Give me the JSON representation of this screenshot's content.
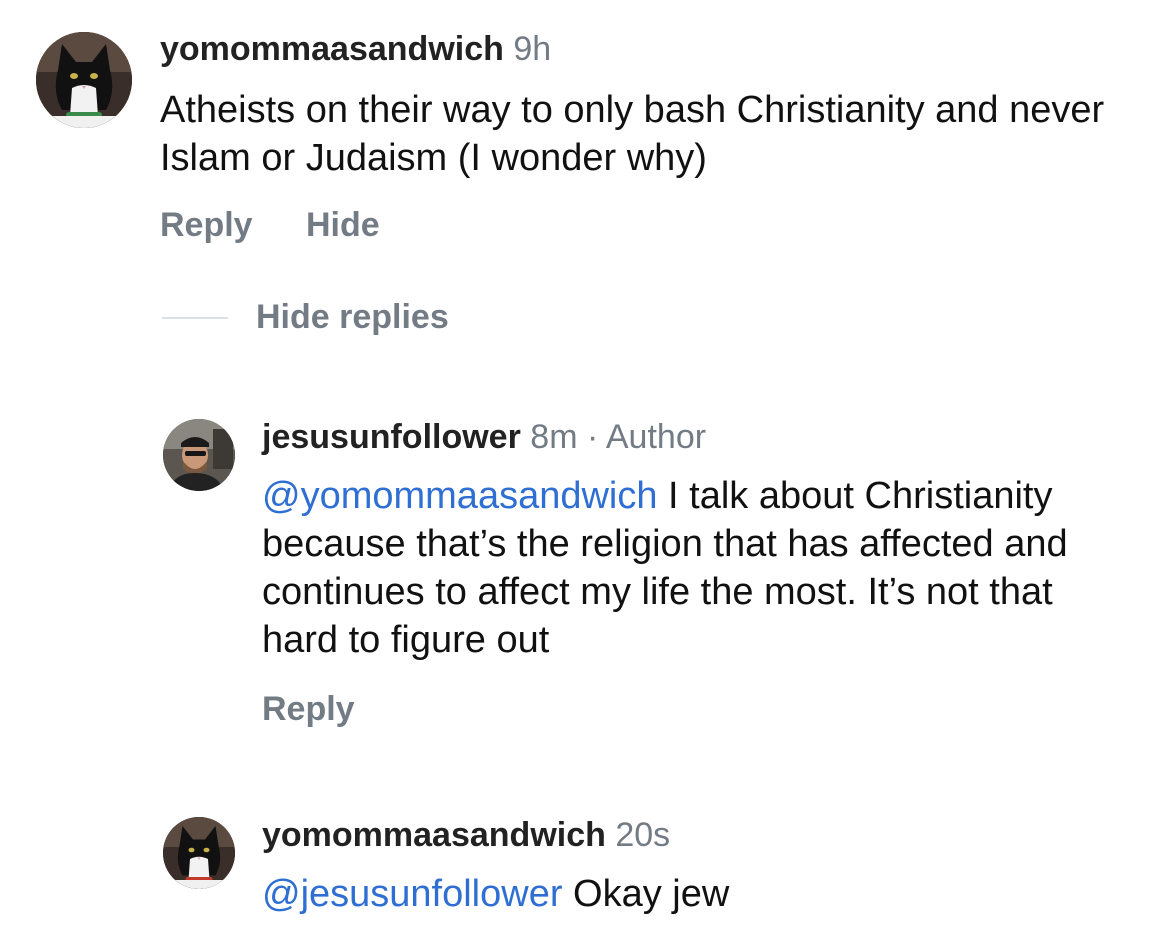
{
  "comments": {
    "c1": {
      "username": "yomommaasandwich",
      "time": "9h",
      "text": "Atheists on their way to only bash Christianity and never Islam or Judaism (I wonder why)",
      "reply_label": "Reply",
      "hide_label": "Hide",
      "hide_replies_label": "Hide replies"
    },
    "c2": {
      "username": "jesusunfollower",
      "time": "8m",
      "separator": "·",
      "badge": "Author",
      "mention": "@yomommaasandwich",
      "text": " I talk about Christianity because that’s the religion that has affected and continues to affect my life the most. It’s not that hard to figure out",
      "reply_label": "Reply"
    },
    "c3": {
      "username": "yomommaasandwich",
      "time": "20s",
      "mention": "@jesusunfollower",
      "text": " Okay jew"
    }
  },
  "colors": {
    "mention": "#2f6fd3",
    "muted": "#737b85",
    "text": "#111111",
    "divider": "#dcdfe3"
  },
  "icons": {
    "avatar_1": "cat-avatar-icon",
    "avatar_2": "man-avatar-icon",
    "avatar_3": "cat-avatar-icon"
  }
}
